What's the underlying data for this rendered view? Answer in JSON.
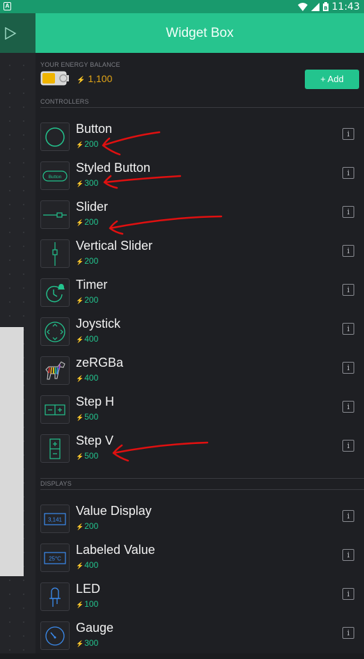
{
  "status_bar": {
    "time": "11:43",
    "notification_icon": "alert-icon"
  },
  "header": {
    "title": "Widget Box"
  },
  "energy": {
    "label": "YOUR ENERGY BALANCE",
    "value": "1,100",
    "add_label": "+ Add"
  },
  "controllers": {
    "label": "CONTROLLERS",
    "items": [
      {
        "name": "Button",
        "price": "200",
        "icon": "button-circle-icon"
      },
      {
        "name": "Styled Button",
        "price": "300",
        "icon": "styled-button-icon"
      },
      {
        "name": "Slider",
        "price": "200",
        "icon": "slider-icon"
      },
      {
        "name": "Vertical Slider",
        "price": "200",
        "icon": "vertical-slider-icon"
      },
      {
        "name": "Timer",
        "price": "200",
        "icon": "timer-icon"
      },
      {
        "name": "Joystick",
        "price": "400",
        "icon": "joystick-icon"
      },
      {
        "name": "zeRGBa",
        "price": "400",
        "icon": "zebra-icon"
      },
      {
        "name": "Step H",
        "price": "500",
        "icon": "step-h-icon"
      },
      {
        "name": "Step V",
        "price": "500",
        "icon": "step-v-icon"
      }
    ]
  },
  "displays": {
    "label": "DISPLAYS",
    "items": [
      {
        "name": "Value Display",
        "price": "200",
        "icon": "value-display-icon",
        "icon_text": "3,141"
      },
      {
        "name": "Labeled Value",
        "price": "400",
        "icon": "labeled-value-icon",
        "icon_text": "25°C"
      },
      {
        "name": "LED",
        "price": "100",
        "icon": "led-icon"
      },
      {
        "name": "Gauge",
        "price": "300",
        "icon": "gauge-icon"
      }
    ]
  },
  "styled_button_icon_text": "Button",
  "info_glyph": "i",
  "bolt_glyph": "⚡",
  "colors": {
    "accent": "#23c48e",
    "header": "#27c48e",
    "energy": "#e3a517",
    "annotation": "#e01010"
  }
}
